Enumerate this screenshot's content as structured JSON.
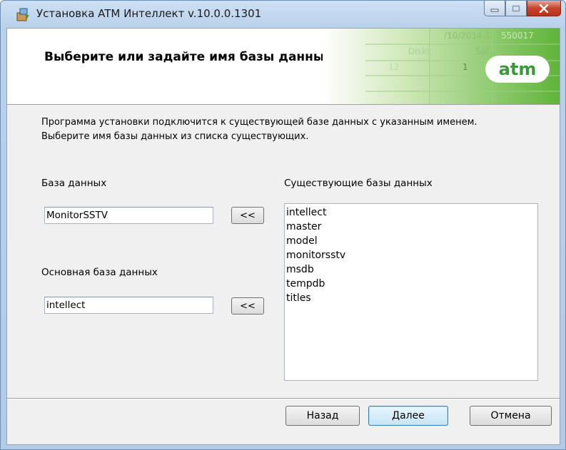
{
  "window": {
    "title": "Установка ATM Интеллект v.10.0.0.1301",
    "icon": "installer-icon"
  },
  "banner": {
    "title": "Выберите или задайте имя базы данных.",
    "logo": "atm",
    "art_fragments": [
      "/10/2014 1",
      "550017",
      "Disks",
      "Sof",
      "12",
      "1"
    ]
  },
  "description": {
    "line1": "Программа установки подключится к существующей базе данных с указанным именем.",
    "line2": "Выберите имя базы данных из списка существующих."
  },
  "database": {
    "label": "База данных",
    "value": "MonitorSSTV",
    "pick_button": "<<"
  },
  "main_database": {
    "label": "Основная база данных",
    "value": "intellect",
    "pick_button": "<<"
  },
  "existing": {
    "label": "Существующие базы данных",
    "items": [
      "intellect",
      "master",
      "model",
      "monitorsstv",
      "msdb",
      "tempdb",
      "titles"
    ]
  },
  "buttons": {
    "back": "Назад",
    "next": "Далее",
    "cancel": "Отмена"
  },
  "colors": {
    "banner_green": "#6fbf4a",
    "logo_text": "#3a9a3a",
    "close_button": "#c7432b"
  }
}
